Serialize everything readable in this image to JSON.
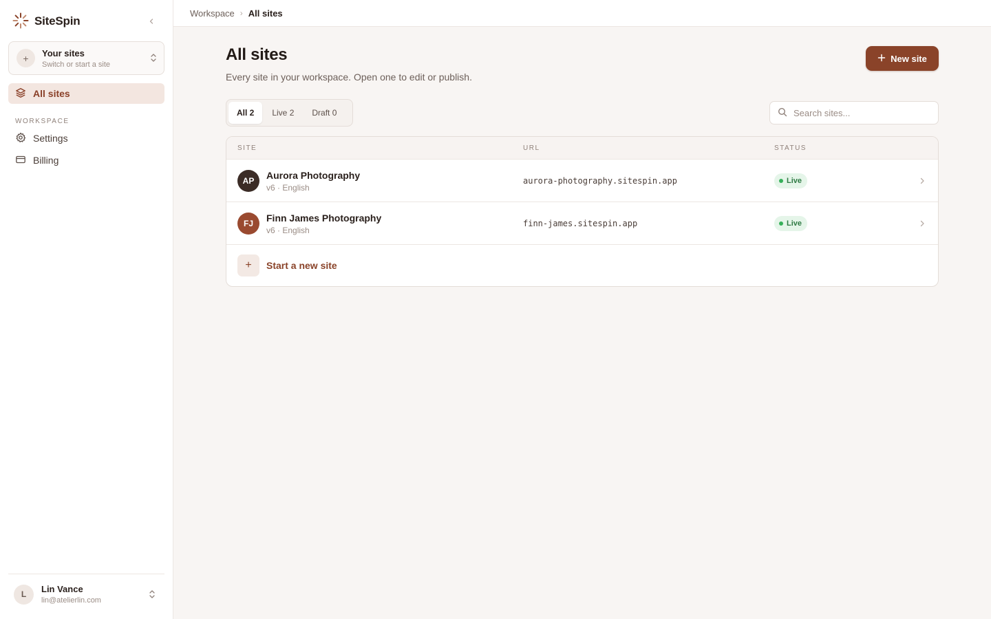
{
  "app": {
    "name": "SiteSpin",
    "brand_color": "#8a4329"
  },
  "sidebar": {
    "switcher": {
      "title": "Your sites",
      "subtitle": "Switch or start a site"
    },
    "active_item": {
      "label": "All sites",
      "icon": "layers-icon"
    },
    "section_label": "WORKSPACE",
    "items": [
      {
        "label": "Settings",
        "icon": "gear-icon"
      },
      {
        "label": "Billing",
        "icon": "credit-card-icon"
      }
    ],
    "user": {
      "initial": "L",
      "name": "Lin Vance",
      "email": "lin@atelierlin.com"
    }
  },
  "breadcrumb": {
    "root": "Workspace",
    "separator": "›",
    "current": "All sites"
  },
  "main": {
    "title": "All sites",
    "subtitle": "Every site in your workspace. Open one to edit or publish.",
    "new_button": "New site",
    "tabs": [
      {
        "label": "All 2",
        "active": true
      },
      {
        "label": "Live 2",
        "active": false
      },
      {
        "label": "Draft 0",
        "active": false
      }
    ],
    "search": {
      "placeholder": "Search sites...",
      "value": ""
    },
    "table": {
      "columns": [
        "SITE",
        "URL",
        "STATUS"
      ],
      "rows": [
        {
          "initials": "AP",
          "avatar_color": "#3b2c26",
          "name": "Aurora Photography",
          "meta": "v6 · English",
          "url": "aurora-photography.sitespin.app",
          "status": "Live"
        },
        {
          "initials": "FJ",
          "avatar_color": "#9a4a30",
          "name": "Finn James Photography",
          "meta": "v6 · English",
          "url": "finn-james.sitespin.app",
          "status": "Live"
        }
      ],
      "new_row_label": "Start a new site"
    }
  }
}
